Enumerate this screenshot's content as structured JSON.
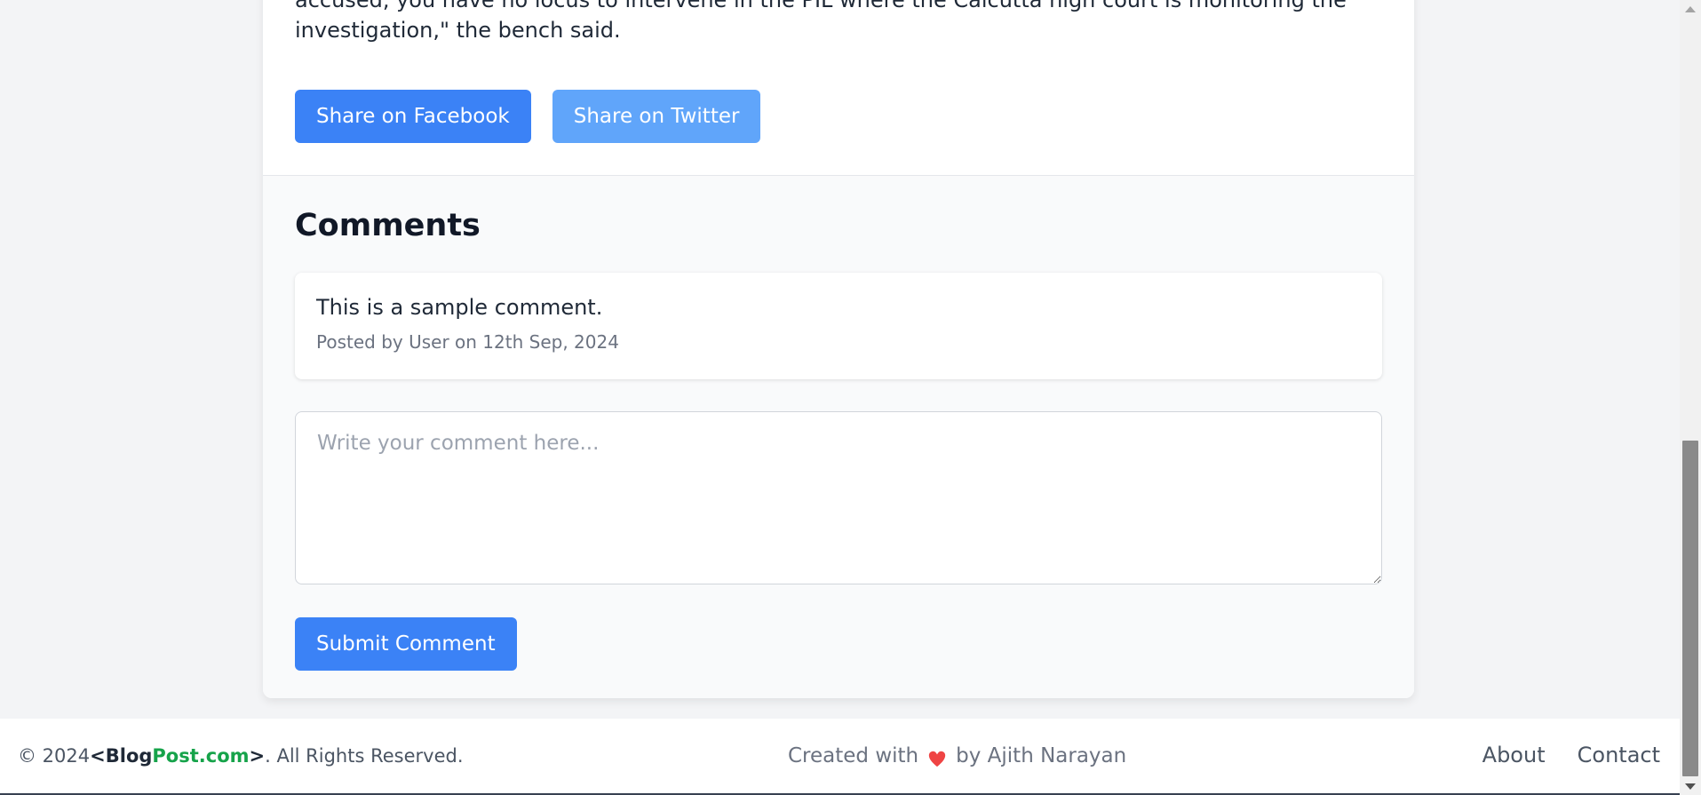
{
  "article": {
    "partial_line": "accused, you have no locus to intervene in the PIL where the Calcutta high court is monitoring the",
    "last_line": "investigation,\" the bench said."
  },
  "share": {
    "facebook_label": "Share on Facebook",
    "twitter_label": "Share on Twitter"
  },
  "comments": {
    "title": "Comments",
    "items": [
      {
        "text": "This is a sample comment.",
        "meta": "Posted by User on 12th Sep, 2024"
      }
    ],
    "input_placeholder": "Write your comment here...",
    "input_value": "",
    "submit_label": "Submit Comment"
  },
  "footer": {
    "copyright_prefix": "© 2024",
    "brand_open": "<",
    "brand_blog": "Blog",
    "brand_post": "Post.com",
    "brand_close": ">",
    "copyright_suffix": ". All Rights Reserved.",
    "created_prefix": "Created with",
    "created_suffix": "by Ajith Narayan",
    "nav": [
      {
        "label": "About"
      },
      {
        "label": "Contact"
      }
    ]
  },
  "colors": {
    "primary_button": "#3b82f6",
    "secondary_button": "#60a5fa",
    "brand_green": "#16a34a",
    "heart_red": "#ef4444"
  },
  "icons": {
    "heart": "heart-icon",
    "scroll_up": "scroll-up-arrow-icon",
    "scroll_down": "scroll-down-arrow-icon"
  }
}
